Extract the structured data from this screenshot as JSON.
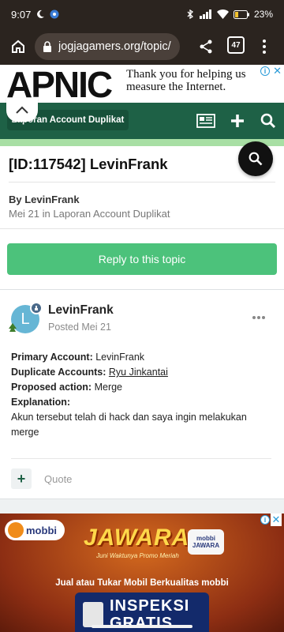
{
  "status_bar": {
    "time": "9:07",
    "battery": "23%"
  },
  "browser": {
    "url": "jogjagamers.org/topic/",
    "tab_count": "47"
  },
  "ad_top": {
    "brand": "APNIC",
    "text_line1": "Thank you for helping us",
    "text_line2": "measure the Internet.",
    "close": "✕"
  },
  "site_header": {
    "breadcrumb": "Laporan Account Duplikat"
  },
  "topic": {
    "title": "[ID:117542] LevinFrank",
    "by_label": "By LevinFrank",
    "meta": "Mei 21 in Laporan Account Duplikat",
    "reply_button": "Reply to this topic"
  },
  "post": {
    "avatar_letter": "L",
    "author": "LevinFrank",
    "posted": "Posted Mei 21",
    "primary_label": "Primary Account:",
    "primary_value": "LevinFrank",
    "duplicate_label": "Duplicate Accounts:",
    "duplicate_value": "Ryu Jinkantai",
    "action_label": "Proposed action:",
    "action_value": "Merge",
    "explanation_label": "Explanation:",
    "explanation_text": "Akun tersebut telah di hack dan saya ingin melakukan merge",
    "plus_label": "+",
    "quote_label": "Quote"
  },
  "ad_bottom": {
    "brand": "mobbi",
    "headline": "JAWARA",
    "tagline": "Juni Waktunya Promo Meriah",
    "badge": "mobbi JAWARA",
    "subline": "Jual atau Tukar Mobil Berkualitas mobbi",
    "box_line1": "INSPEKSI",
    "box_line2": "GRATIS",
    "close": "✕"
  }
}
